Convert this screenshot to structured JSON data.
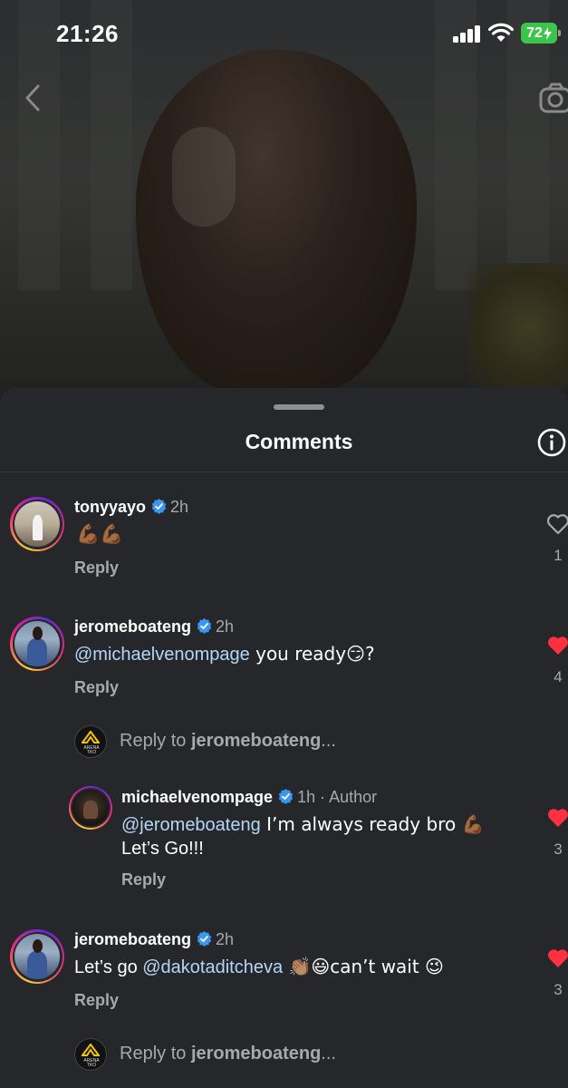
{
  "status_bar": {
    "time": "21:26",
    "battery": "72"
  },
  "header": {
    "back_icon": "chevron-left-icon",
    "camera_icon": "camera-icon"
  },
  "sheet": {
    "title": "Comments",
    "info_icon": "info-icon"
  },
  "colors": {
    "sheet_bg": "#25272b",
    "mention": "#b4d7f7",
    "like_red": "#ff3040",
    "battery_green": "#3bc54a",
    "verified_blue": "#3897f0"
  },
  "comments": [
    {
      "username": "tonyyayo",
      "time": "2h",
      "text": "💪🏾💪🏾",
      "reply": "Reply",
      "likes": "1",
      "liked": false
    },
    {
      "username": "jeromeboateng",
      "time": "2h",
      "mention": "@michaelvenompage",
      "text": " you ready😏?",
      "reply": "Reply",
      "likes": "4",
      "liked": true
    },
    {
      "username": "michaelvenompage",
      "time": "1h",
      "author_label": " · Author",
      "mention": "@jeromeboateng",
      "text": " I’m always ready bro 💪🏾",
      "text2": "Let’s Go!!!",
      "reply": "Reply",
      "likes": "3",
      "liked": true
    },
    {
      "username": "jeromeboateng",
      "time": "2h",
      "text_prefix": "Let’s go ",
      "mention": "@dakotaditcheva",
      "text": " 👏🏽😃can’t wait 😉",
      "reply": "Reply",
      "likes": "3",
      "liked": true
    }
  ],
  "reply_prompts": [
    {
      "prefix": "Reply to ",
      "target": "jeromeboateng",
      "suffix": "..."
    },
    {
      "prefix": "Reply to ",
      "target": "jeromeboateng",
      "suffix": "..."
    }
  ],
  "arena_logo_text": "ARENA TKO"
}
